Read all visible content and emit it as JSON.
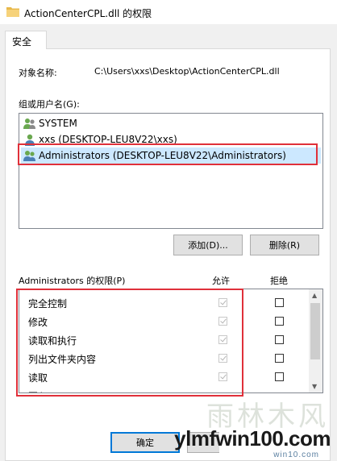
{
  "window": {
    "title": "ActionCenterCPL.dll 的权限"
  },
  "tabs": [
    {
      "label": "安全"
    }
  ],
  "object": {
    "label": "对象名称:",
    "value": "C:\\Users\\xxs\\Desktop\\ActionCenterCPL.dll"
  },
  "groups": {
    "label": "组或用户名(G):",
    "items": [
      {
        "name": "SYSTEM",
        "icon": "users-group-icon"
      },
      {
        "name": "xxs (DESKTOP-LEU8V22\\xxs)",
        "icon": "user-icon"
      },
      {
        "name": "Administrators (DESKTOP-LEU8V22\\Administrators)",
        "icon": "users-group-icon"
      }
    ],
    "selected_index": 2,
    "add_button": "添加(D)...",
    "remove_button": "删除(R)"
  },
  "permissions": {
    "label": "Administrators 的权限(P)",
    "allow_header": "允许",
    "deny_header": "拒绝",
    "rows": [
      {
        "name": "完全控制",
        "allow": true,
        "deny": false
      },
      {
        "name": "修改",
        "allow": true,
        "deny": false
      },
      {
        "name": "读取和执行",
        "allow": true,
        "deny": false
      },
      {
        "name": "列出文件夹内容",
        "allow": true,
        "deny": false
      },
      {
        "name": "读取",
        "allow": true,
        "deny": false
      },
      {
        "name": "写入",
        "allow": false,
        "deny": false
      }
    ]
  },
  "footer": {
    "ok_button": "确定"
  },
  "watermark": {
    "text": "ylmfwin100.com",
    "sub": "win10.com",
    "han": "雨林木风"
  },
  "colors": {
    "highlight_box": "#e0303a",
    "selection": "#cce8ff",
    "folder": "#e8b84a"
  }
}
